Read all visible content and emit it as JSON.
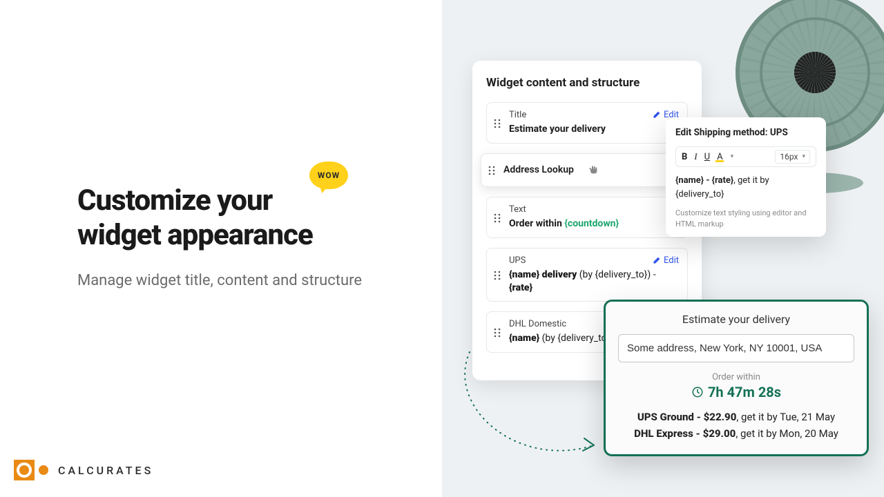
{
  "left": {
    "headline_l1": "Customize your",
    "headline_l2": "widget appearance",
    "subhead": "Manage widget title, content and structure",
    "wow": "WOW",
    "brand": "CALCURATES"
  },
  "settings": {
    "heading": "Widget content and structure",
    "edit_label": "Edit",
    "rows": {
      "title": {
        "type": "Title",
        "value": "Estimate your delivery"
      },
      "address": {
        "value": "Address Lookup"
      },
      "text": {
        "type": "Text",
        "prefix": "Order within ",
        "token": "{countdown}"
      },
      "ups": {
        "type": "UPS",
        "bold1": "{name} delivery",
        "mid": " (by {delivery_to}) - ",
        "bold2": "{rate}"
      },
      "dhl": {
        "type": "DHL Domestic",
        "bold1": "{name}",
        "mid": " (by {delivery_to})"
      }
    }
  },
  "editor": {
    "title": "Edit Shipping method: UPS",
    "size": "16px",
    "line_bold": "{name} - {rate}",
    "line_tail": ", get it by {delivery_to}",
    "hint": "Customize text styling using editor and HTML markup"
  },
  "preview": {
    "title": "Estimate your delivery",
    "address": "Some address, New York, NY 10001, USA",
    "order_within_label": "Order within",
    "countdown": "7h 47m 28s",
    "rate1_bold": "UPS Ground - $22.90",
    "rate1_tail": ", get it by Tue, 21 May",
    "rate2_bold": "DHL Express - $29.00",
    "rate2_tail": ", get it by Mon, 20 May"
  }
}
